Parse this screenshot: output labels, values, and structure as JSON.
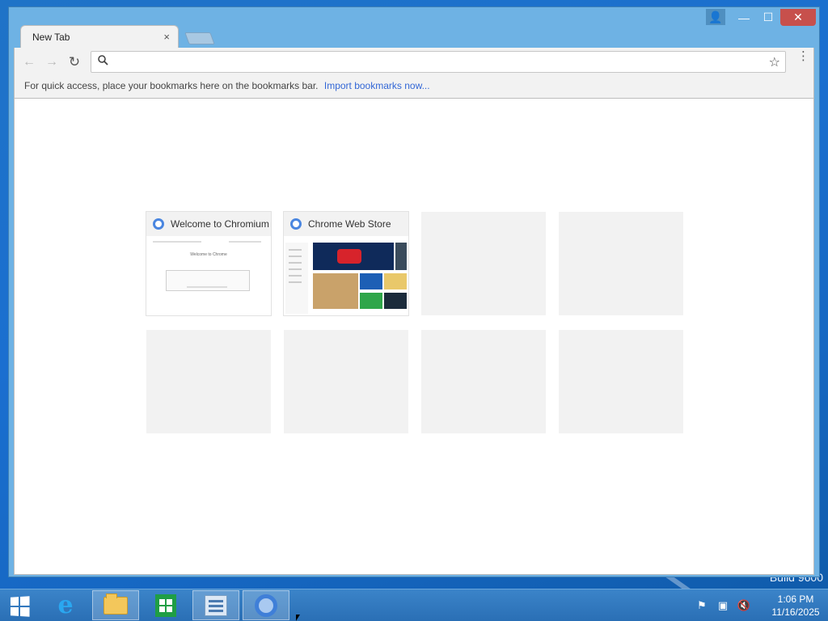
{
  "window": {
    "tab_title": "New Tab",
    "tab_close": "×",
    "caption": {
      "user": "👤",
      "minimize": "—",
      "maximize": "☐",
      "close": "✕"
    }
  },
  "toolbar": {
    "back": "←",
    "forward": "→",
    "reload": "↻",
    "search_icon": "🔍",
    "omnibox_value": "",
    "omnibox_placeholder": "",
    "star": "☆",
    "menu": "⋮"
  },
  "bookmarks_bar": {
    "text": "For quick access, place your bookmarks here on the bookmarks bar.",
    "import_link": "Import bookmarks now..."
  },
  "most_visited": {
    "tiles": [
      {
        "title": "Welcome to Chromium",
        "thumb_text": "Welcome to Chrome"
      },
      {
        "title": "Chrome Web Store"
      }
    ]
  },
  "desktop": {
    "watermark": "Build 9600"
  },
  "taskbar": {
    "apps": [
      "Internet Explorer",
      "File Explorer",
      "Store",
      "Control Panel",
      "Chromium"
    ],
    "clock_time": "1:06 PM",
    "clock_date": "11/16/2025"
  },
  "colors": {
    "accent": "#3367d6",
    "window_frame": "#6eb2e4",
    "taskbar": "#2a6fb5",
    "close_button": "#c7504c"
  }
}
